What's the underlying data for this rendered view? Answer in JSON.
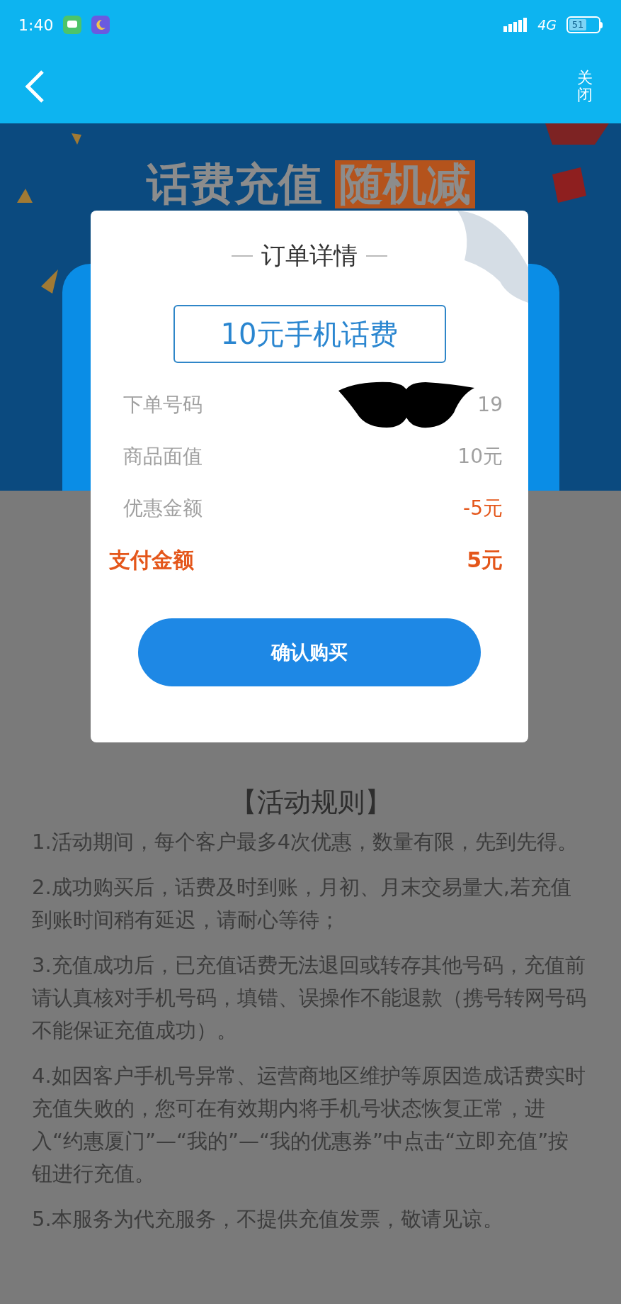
{
  "status_bar": {
    "time": "1:40",
    "network": "4G",
    "battery": "51"
  },
  "header": {
    "close": "关闭"
  },
  "banner": {
    "title": "话费充值",
    "highlight": "随机减"
  },
  "dialog": {
    "title": "订单详情",
    "product": "10元手机话费",
    "rows": [
      {
        "label": "下单号码",
        "value": "19",
        "kind": "redacted"
      },
      {
        "label": "商品面值",
        "value": "10元",
        "kind": "normal"
      },
      {
        "label": "优惠金额",
        "value": "-5元",
        "kind": "discount"
      },
      {
        "label": "支付金额",
        "value": "5元",
        "kind": "total"
      }
    ],
    "button": "确认购买"
  },
  "rules": {
    "title": "【活动规则】",
    "items": [
      "1.活动期间，每个客户最多4次优惠，数量有限，先到先得。",
      "2.成功购买后，话费及时到账，月初、月末交易量大,若充值到账时间稍有延迟，请耐心等待；",
      "3.充值成功后，已充值话费无法退回或转存其他号码，充值前请认真核对手机号码，填错、误操作不能退款（携号转网号码不能保证充值成功）。",
      "4.如因客户手机号异常、运营商地区维护等原因造成话费实时充值失败的，您可在有效期内将手机号状态恢复正常，进入“约惠厦门”—“我的”—“我的优惠券”中点击“立即充值”按钮进行充值。",
      "5.本服务为代充服务，不提供充值发票，敬请见谅。"
    ]
  }
}
